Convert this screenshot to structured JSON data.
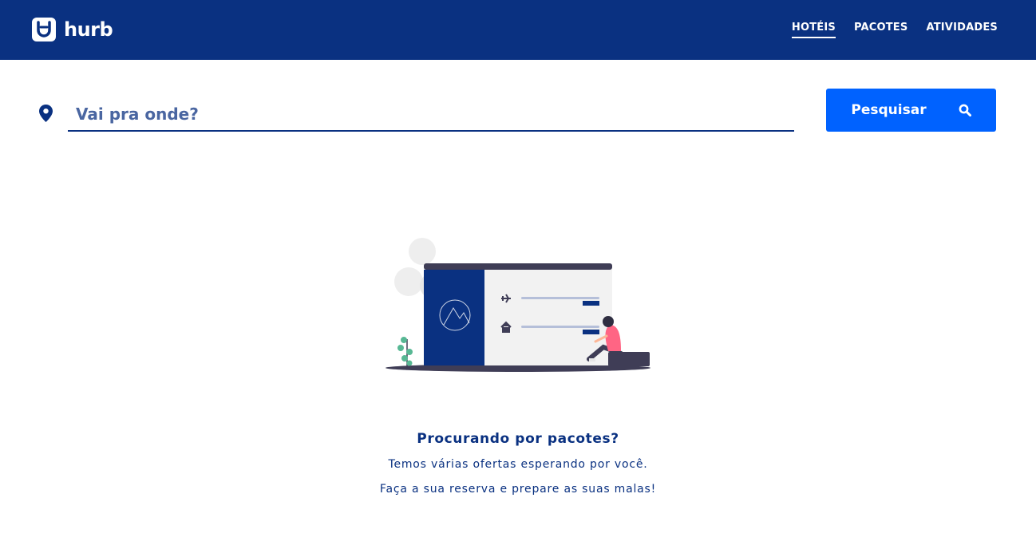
{
  "brand": {
    "name": "hurb"
  },
  "nav": {
    "items": [
      {
        "label": "HOTÉIS",
        "active": true
      },
      {
        "label": "PACOTES",
        "active": false
      },
      {
        "label": "ATIVIDADES",
        "active": false
      }
    ]
  },
  "search": {
    "placeholder": "Vai pra onde?",
    "value": "",
    "button_label": "Pesquisar"
  },
  "empty_state": {
    "title": "Procurando por pacotes?",
    "line1": "Temos várias ofertas esperando por você.",
    "line2": "Faça a sua reserva e prepare as suas malas!"
  },
  "colors": {
    "header_bg": "#0a3181",
    "primary_button": "#0062ff",
    "text_primary": "#0a3181"
  },
  "icons": {
    "logo": "hurb-logo-icon",
    "location": "map-pin-icon",
    "search": "search-icon",
    "plane": "plane-icon",
    "home": "home-icon"
  }
}
